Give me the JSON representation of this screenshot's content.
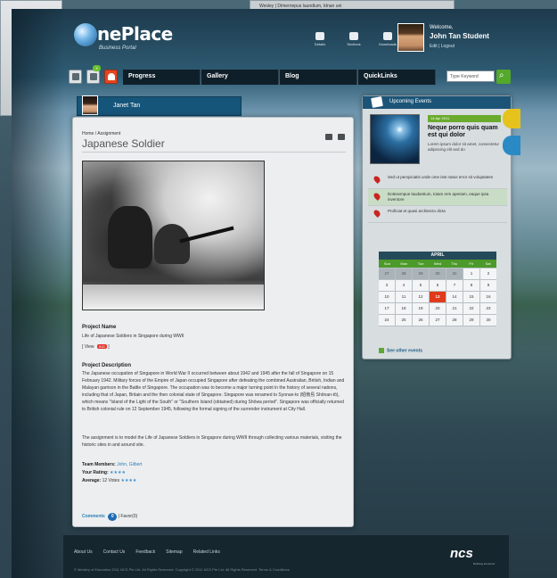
{
  "background": {
    "window_snippet": "Wesley | Dimernepus laundium, Idnan uni"
  },
  "header": {
    "logo_text": "nePlace",
    "logo_tagline": "Business Portal",
    "icons": [
      {
        "label": "Details",
        "icon": "home-icon"
      },
      {
        "label": "Sections",
        "icon": "user-icon"
      },
      {
        "label": "Downloads",
        "icon": "folder-icon"
      }
    ],
    "welcome": "Welcome,",
    "user_name": "John Tan Student",
    "user_links": "Edit  |  Logout"
  },
  "nav": {
    "badge": "3",
    "tabs": [
      "Progress",
      "Gallery",
      "Blog",
      "QuickLinks"
    ],
    "search_placeholder": "Type Keyword"
  },
  "user_strip": {
    "name": "Janet Tan"
  },
  "content": {
    "breadcrumb": "Home / Assignment",
    "title": "Japanese Soldier",
    "project_name_label": "Project Name",
    "project_name": "Life of Japanese Soldiers in Singapore during WWII",
    "view_label": "[ View",
    "view_pill": "BIG",
    "view_end": "]",
    "description_label": "Project Description",
    "description": "The Japanese occupation of Singapore in World War II occurred between about 1942 and 1945 after the fall of Singapore on 15 February 1942. Military forces of the Empire of Japan occupied Singapore after defeating the combined Australian, British, Indian and Malayan garrison in the Battle of Singapore. The occupation was to become a major turning point in the history of several nations, including that of Japan, Britain and the then colonial state of Singapore. Singapore was renamed to Syonan-to (昭南島 Shōnan-tō), which means \"Island of the Light of the South\" or \"Southern Island (obtained) during Shōwa period\". Singapore was officially returned to British colonial rule on 12 September 1945, following the formal signing of the surrender instrument at City Hall.",
    "assignment": "The assignment is to model the Life of Japanese Soldiers in Singapore during WWII through collecting various materials, visiting the historic sites in and around site.",
    "team_label": "Team Members:",
    "team": "John, Gilbert",
    "rating_label": "Your Rating:",
    "rating_stars": "★★★★",
    "average_label": "Average:",
    "average_text": "12 Votes",
    "average_stars": "★★★★",
    "comments_label": "Comments",
    "comments_count": "0",
    "comments_rest": "|   Favor(0)"
  },
  "upcoming": {
    "heading": "Upcoming Events",
    "feat_date": "14 Apr 2011",
    "feat_title": "Neque porro quis quam est qui dolor",
    "feat_text": "Lorem ipsum dolor sit amet, consectetur adipiscing elit sed do",
    "events": [
      "Sed ut perspiciatis unde ome iste natus error sit voluptatem",
      "Dolesempue laudantium, totam rem aperiam, eaque ipsa inventore",
      "Proficiat et quasi architecto dicta"
    ],
    "calendar": {
      "month": "APRIL",
      "days": [
        "Sun",
        "Mon",
        "Tue",
        "Wed",
        "Thu",
        "Fri",
        "Sat"
      ],
      "cells": [
        "27",
        "28",
        "29",
        "30",
        "31",
        "1",
        "2",
        "3",
        "4",
        "5",
        "6",
        "7",
        "8",
        "9",
        "10",
        "11",
        "12",
        "13",
        "14",
        "15",
        "16",
        "17",
        "18",
        "19",
        "20",
        "21",
        "22",
        "23",
        "24",
        "25",
        "26",
        "27",
        "28",
        "29",
        "30"
      ],
      "muted_count": 5,
      "today": "13"
    },
    "see_all": "See other events"
  },
  "footer": {
    "links": [
      "About Us",
      "Contact Us",
      "Feedback",
      "Sitemap",
      "Related Links"
    ],
    "copyright": "© Ministry of Education 2011 NCS Pte Ltd. All Rights Reserved. Copyright © 2011 NCS Pte Ltd. All Rights Reserved. Terms & Conditions",
    "brand": "ncs",
    "brand_tag": "Defining tomorrow"
  },
  "colors": {
    "accent_green": "#54a82a",
    "accent_blue": "#16557a",
    "alert_red": "#e3451f"
  }
}
